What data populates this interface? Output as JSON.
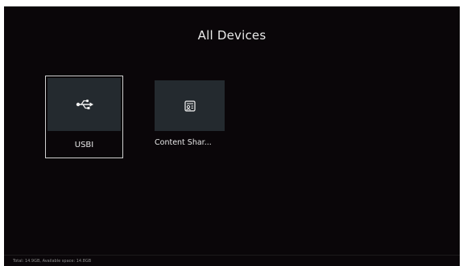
{
  "page": {
    "title": "All Devices"
  },
  "devices": [
    {
      "label": "USBI",
      "icon": "usb-icon",
      "selected": true
    },
    {
      "label": "Content Shar...",
      "icon": "content-share-icon",
      "selected": false
    }
  ],
  "status_bar": {
    "text": "Total: 14.9GB, Available space: 14.8GB"
  },
  "colors": {
    "background": "#0a0609",
    "tile": "#242a2f",
    "focus_border": "#cfcfcf",
    "text": "#e9e9e9"
  }
}
